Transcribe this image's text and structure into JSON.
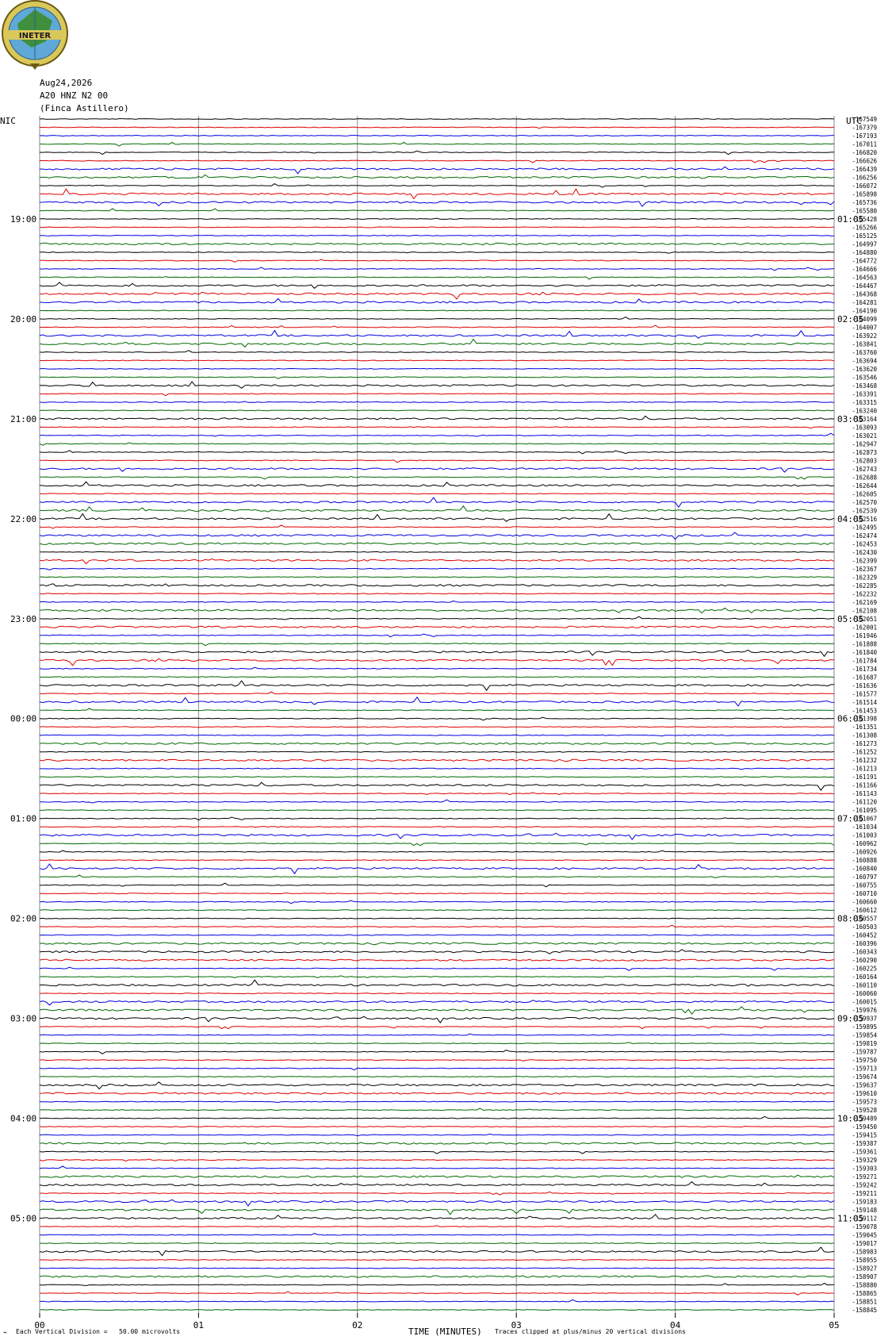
{
  "header": {
    "date": "Aug24,2026",
    "station": "A20 HNZ N2 00",
    "location": "(Finca Astillero)",
    "logo_text": "INETER",
    "left_timezone": "NIC",
    "right_timezone": "UTC"
  },
  "footer": {
    "scale_note": "Each Vertical Division =   50.00 microvolts",
    "xlabel": "TIME (MINUTES)",
    "clip_note": "Traces clipped at plus/minus 20 vertical divisions"
  },
  "colors": {
    "trace_cycle": [
      "#000000",
      "#e00000",
      "#0000e0",
      "#006a00"
    ],
    "grid_vertical": "#8a8a8a"
  },
  "chart_data": {
    "type": "line",
    "title": "",
    "x_ticks": [
      "00",
      "01",
      "02",
      "03",
      "04",
      "05"
    ],
    "xlim": [
      0,
      5
    ],
    "trace_count": 144,
    "minutes_per_trace": 5,
    "left_hour_labels": [
      "19:00",
      "20:00",
      "21:00",
      "22:00",
      "23:00",
      "00:00",
      "01:00",
      "02:00",
      "03:00",
      "04:00",
      "05:00"
    ],
    "right_hour_labels": [
      "01:05",
      "02:05",
      "03:05",
      "04:05",
      "05:05",
      "06:05",
      "07:05",
      "08:05",
      "09:05",
      "10:05",
      "11:05"
    ],
    "hour_label_first_trace_index": 12,
    "trace_offsets": [
      -167549,
      -167379,
      -167193,
      -167011,
      -166820,
      -166626,
      -166439,
      -166256,
      -166072,
      -165898,
      -165736,
      -165580,
      -165428,
      -165266,
      -165125,
      -164997,
      -164880,
      -164772,
      -164666,
      -164563,
      -164467,
      -164368,
      -164281,
      -164190,
      -164099,
      -164007,
      -163922,
      -163841,
      -163760,
      -163694,
      -163620,
      -163546,
      -163468,
      -163391,
      -163315,
      -163240,
      -163164,
      -163093,
      -163021,
      -162947,
      -162873,
      -162803,
      -162743,
      -162688,
      -162644,
      -162605,
      -162570,
      -162539,
      -162516,
      -162495,
      -162474,
      -162453,
      -162430,
      -162399,
      -162367,
      -162329,
      -162285,
      -162232,
      -162169,
      -162108,
      -162051,
      -162001,
      -161946,
      -161888,
      -161840,
      -161784,
      -161734,
      -161687,
      -161636,
      -161577,
      -161514,
      -161453,
      -161398,
      -161351,
      -161308,
      -161273,
      -161252,
      -161232,
      -161213,
      -161191,
      -161166,
      -161143,
      -161120,
      -161095,
      -161067,
      -161034,
      -161003,
      -160962,
      -160926,
      -160888,
      -160840,
      -160797,
      -160755,
      -160710,
      -160660,
      -160612,
      -160557,
      -160503,
      -160452,
      -160396,
      -160343,
      -160290,
      -160225,
      -160164,
      -160110,
      -160060,
      -160015,
      -159976,
      -159937,
      -159895,
      -159854,
      -159819,
      -159787,
      -159750,
      -159713,
      -159674,
      -159637,
      -159610,
      -159573,
      -159528,
      -159489,
      -159450,
      -159415,
      -159387,
      -159361,
      -159329,
      -159303,
      -159271,
      -159242,
      -159211,
      -159183,
      -159148,
      -159112,
      -159078,
      -159045,
      -159017,
      -158983,
      -158955,
      -158927,
      -158907,
      -158880,
      -158865,
      -158851,
      -158845
    ]
  }
}
